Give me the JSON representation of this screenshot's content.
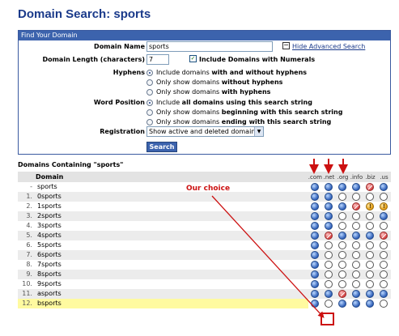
{
  "page_title": "Domain Search: sports",
  "form": {
    "header": "Find Your Domain",
    "domain_name_label": "Domain Name",
    "domain_name_value": "sports",
    "hide_advanced_label": "Hide Advanced Search",
    "length_label": "Domain Length (characters)",
    "length_value": "7",
    "include_numerals_label": "Include Domains with Numerals",
    "hyphens_label": "Hyphens",
    "hyphen_options": [
      {
        "prefix": "Include domains ",
        "bold": "with and without hyphens",
        "selected": true
      },
      {
        "prefix": "Only show domains ",
        "bold": "without hyphens",
        "selected": false
      },
      {
        "prefix": "Only show domains ",
        "bold": "with hyphens",
        "selected": false
      }
    ],
    "word_position_label": "Word Position",
    "word_position_options": [
      {
        "prefix": "Include ",
        "bold": "all domains using this search string",
        "selected": true
      },
      {
        "prefix": "Only show domains ",
        "bold": "beginning with this search string",
        "selected": false
      },
      {
        "prefix": "Only show domains ",
        "bold": "ending with this search string",
        "selected": false
      }
    ],
    "registration_label": "Registration",
    "registration_value": "Show active and deleted domains",
    "search_button": "Search"
  },
  "results": {
    "section_label": "Domains Containing \"sports\"",
    "domain_header": "Domain",
    "tlds": [
      ".com",
      ".net",
      ".org",
      ".info",
      ".biz",
      ".us"
    ],
    "rows": [
      {
        "num": "-",
        "domain": "sports",
        "status": [
          "taken",
          "taken",
          "taken",
          "taken",
          "del",
          "taken"
        ]
      },
      {
        "num": "1.",
        "domain": "0sports",
        "status": [
          "taken",
          "taken",
          "avail",
          "avail",
          "avail",
          "avail"
        ]
      },
      {
        "num": "2.",
        "domain": "1sports",
        "status": [
          "taken",
          "taken",
          "taken",
          "del",
          "warn",
          "warn"
        ]
      },
      {
        "num": "3.",
        "domain": "2sports",
        "status": [
          "taken",
          "taken",
          "avail",
          "avail",
          "avail",
          "taken"
        ]
      },
      {
        "num": "4.",
        "domain": "3sports",
        "status": [
          "taken",
          "taken",
          "avail",
          "avail",
          "avail",
          "avail"
        ]
      },
      {
        "num": "5.",
        "domain": "4sports",
        "status": [
          "taken",
          "del",
          "taken",
          "taken",
          "taken",
          "del"
        ]
      },
      {
        "num": "6.",
        "domain": "5sports",
        "status": [
          "taken",
          "avail",
          "avail",
          "avail",
          "avail",
          "avail"
        ]
      },
      {
        "num": "7.",
        "domain": "6sports",
        "status": [
          "taken",
          "avail",
          "avail",
          "avail",
          "avail",
          "avail"
        ]
      },
      {
        "num": "8.",
        "domain": "7sports",
        "status": [
          "taken",
          "avail",
          "avail",
          "avail",
          "avail",
          "avail"
        ]
      },
      {
        "num": "9.",
        "domain": "8sports",
        "status": [
          "taken",
          "avail",
          "avail",
          "avail",
          "avail",
          "avail"
        ]
      },
      {
        "num": "10.",
        "domain": "9sports",
        "status": [
          "taken",
          "avail",
          "avail",
          "avail",
          "avail",
          "avail"
        ]
      },
      {
        "num": "11.",
        "domain": "asports",
        "status": [
          "taken",
          "taken",
          "del",
          "taken",
          "taken",
          "taken"
        ]
      },
      {
        "num": "12.",
        "domain": "bsports",
        "status": [
          "taken",
          "avail",
          "taken",
          "taken",
          "taken",
          "avail"
        ],
        "highlight": true
      }
    ]
  },
  "annotation": {
    "text": "Our choice",
    "color": "#cc1111"
  },
  "colors": {
    "title": "#1a3a8a",
    "header_bar": "#3c63ad",
    "highlight": "#fffaa0"
  }
}
